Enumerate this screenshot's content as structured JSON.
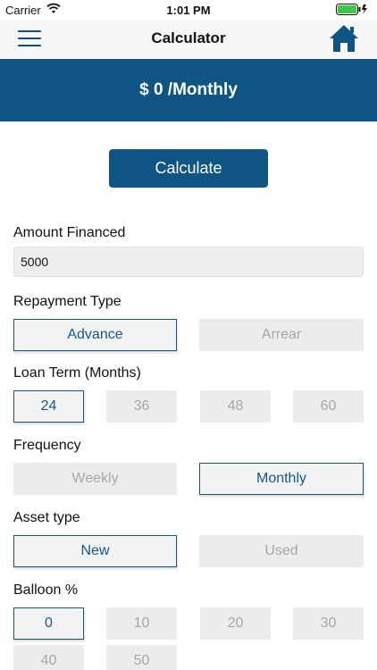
{
  "status_bar": {
    "carrier": "Carrier",
    "time": "1:01 PM"
  },
  "nav": {
    "title": "Calculator",
    "menu_icon": "hamburger-menu-icon",
    "home_icon": "home-icon"
  },
  "banner": {
    "amount": "$ 0 /Monthly"
  },
  "calculate_label": "Calculate",
  "amount_financed": {
    "label": "Amount Financed",
    "value": "5000"
  },
  "repayment_type": {
    "label": "Repayment Type",
    "options": [
      "Advance",
      "Arrear"
    ],
    "selected": "Advance"
  },
  "loan_term": {
    "label": "Loan Term (Months)",
    "options": [
      "24",
      "36",
      "48",
      "60"
    ],
    "selected": "24"
  },
  "frequency": {
    "label": "Frequency",
    "options": [
      "Weekly",
      "Monthly"
    ],
    "selected": "Monthly"
  },
  "asset_type": {
    "label": "Asset type",
    "options": [
      "New",
      "Used"
    ],
    "selected": "New"
  },
  "balloon": {
    "label": "Balloon %",
    "options": [
      "0",
      "10",
      "20",
      "30",
      "40",
      "50"
    ],
    "selected": "0"
  },
  "colors": {
    "brand": "#0f5584",
    "option_bg": "#ececec",
    "option_text": "#a7a7a7"
  }
}
